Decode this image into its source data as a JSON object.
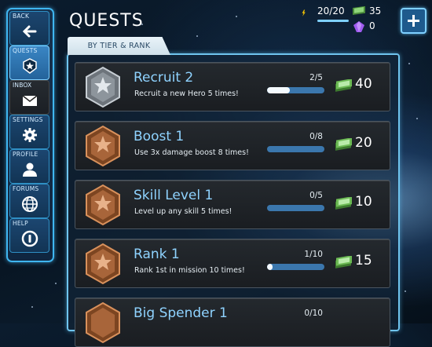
{
  "header": {
    "title": "QUESTS",
    "energy": "20/20",
    "cash": "35",
    "gems": "0"
  },
  "sidebar": {
    "items": [
      {
        "label": "BACK",
        "icon": "back-arrow-icon"
      },
      {
        "label": "QUESTS",
        "icon": "quest-badge-icon"
      },
      {
        "label": "INBOX",
        "icon": "envelope-icon"
      },
      {
        "label": "SETTINGS",
        "icon": "gear-icon"
      },
      {
        "label": "PROFILE",
        "icon": "person-icon"
      },
      {
        "label": "FORUMS",
        "icon": "globe-icon"
      },
      {
        "label": "HELP",
        "icon": "info-icon"
      }
    ]
  },
  "tab": {
    "label": "BY TIER & RANK"
  },
  "quests": [
    {
      "name": "Recruit 2",
      "desc": "Recruit a new Hero 5 times!",
      "progress": "2/5",
      "fill": 0.4,
      "reward": "40",
      "tier": "silver"
    },
    {
      "name": "Boost 1",
      "desc": "Use 3x damage boost 8 times!",
      "progress": "0/8",
      "fill": 0.0,
      "reward": "20",
      "tier": "bronze"
    },
    {
      "name": "Skill Level 1",
      "desc": "Level up any skill 5 times!",
      "progress": "0/5",
      "fill": 0.0,
      "reward": "10",
      "tier": "bronze"
    },
    {
      "name": "Rank 1",
      "desc": "Rank 1st in mission 10 times!",
      "progress": "1/10",
      "fill": 0.1,
      "reward": "15",
      "tier": "bronze"
    },
    {
      "name": "Big Spender 1",
      "desc": "",
      "progress": "0/10",
      "fill": 0.0,
      "reward": "",
      "tier": "bronze"
    }
  ],
  "colors": {
    "accent": "#3fb6f0",
    "quest_name": "#8fd3ff",
    "bronze": "#b06a3b",
    "silver": "#9aa4ad"
  }
}
